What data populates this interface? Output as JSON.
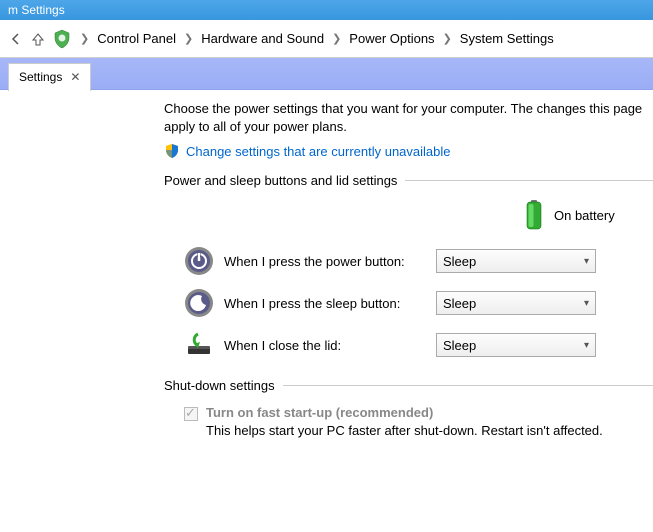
{
  "title_bar": "m Settings",
  "breadcrumbs": {
    "items": [
      "Control Panel",
      "Hardware and Sound",
      "Power Options",
      "System Settings"
    ]
  },
  "tab": {
    "label": "Settings"
  },
  "description": "Choose the power settings that you want for your computer. The changes this page apply to all of your power plans.",
  "change_link": "Change settings that are currently unavailable",
  "section1_title": "Power and sleep buttons and lid settings",
  "battery_label": "On battery",
  "rows": [
    {
      "label": "When I press the power button:",
      "value": "Sleep"
    },
    {
      "label": "When I press the sleep button:",
      "value": "Sleep"
    },
    {
      "label": "When I close the lid:",
      "value": "Sleep"
    }
  ],
  "section2_title": "Shut-down settings",
  "fast_startup": {
    "label": "Turn on fast start-up (recommended)",
    "desc": "This helps start your PC faster after shut-down. Restart isn't affected."
  }
}
